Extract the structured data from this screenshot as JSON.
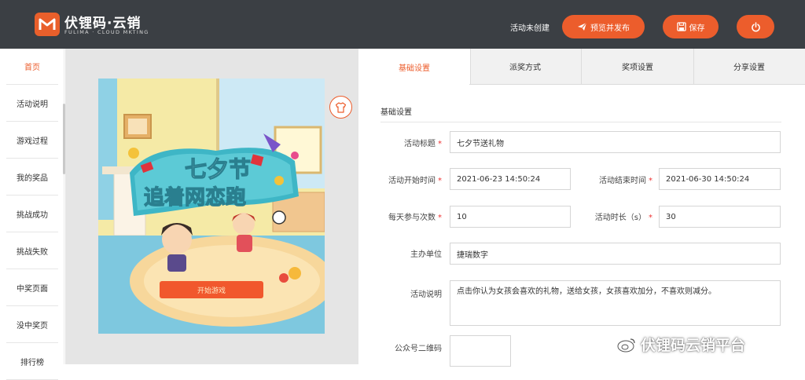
{
  "brand": {
    "name": "伏锂码·云销",
    "subtitle": "FULIMA · CLOUD MKTING"
  },
  "header": {
    "status_text": "活动未创建",
    "preview_publish_label": "预览并发布",
    "save_label": "保存",
    "power_icon": "power-icon"
  },
  "sidebar": {
    "items": [
      {
        "label": "首页",
        "active": true
      },
      {
        "label": "活动说明"
      },
      {
        "label": "游戏过程"
      },
      {
        "label": "我的奖品"
      },
      {
        "label": "挑战成功"
      },
      {
        "label": "挑战失败"
      },
      {
        "label": "中奖页面"
      },
      {
        "label": "没中奖页"
      },
      {
        "label": "排行榜"
      }
    ]
  },
  "preview": {
    "title_line1": "七夕节",
    "title_line2": "追着网恋跑",
    "start_button": "开始游戏",
    "skin_icon": "shirt-icon"
  },
  "tabs": [
    {
      "label": "基础设置",
      "active": true
    },
    {
      "label": "派奖方式"
    },
    {
      "label": "奖项设置"
    },
    {
      "label": "分享设置"
    }
  ],
  "form": {
    "section_title": "基础设置",
    "title_label": "活动标题",
    "title_value": "七夕节送礼物",
    "start_label": "活动开始时间",
    "start_value": "2021-06-23 14:50:24",
    "end_label": "活动结束时间",
    "end_value": "2021-06-30 14:50:24",
    "daily_label": "每天参与次数",
    "daily_value": "10",
    "duration_label": "活动时长（s）",
    "duration_value": "30",
    "organizer_label": "主办单位",
    "organizer_value": "捷瑞数字",
    "desc_label": "活动说明",
    "desc_value": "点击你认为女孩会喜欢的礼物，送给女孩，女孩喜欢加分，不喜欢则减分。",
    "qr_label": "公众号二维码",
    "required_mark": "*"
  },
  "watermark": {
    "text": "伏锂码云销平台"
  },
  "colors": {
    "accent": "#ec5d2c",
    "topbar": "#3b3f44"
  }
}
